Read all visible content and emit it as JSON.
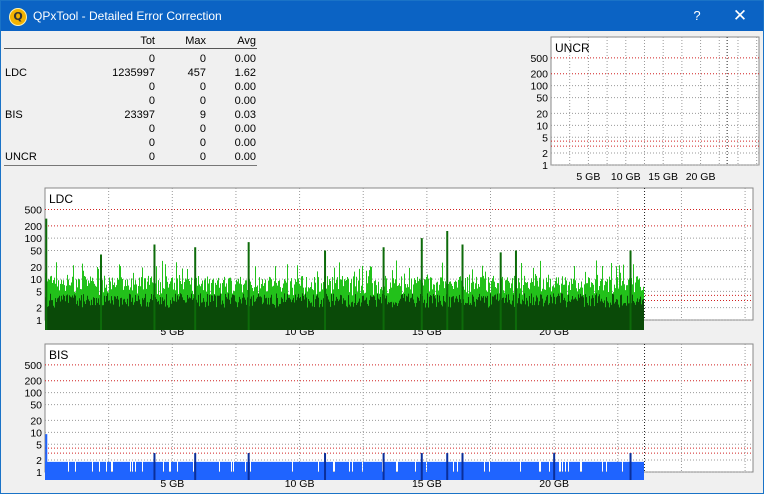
{
  "window": {
    "title": "QPxTool - Detailed Error Correction",
    "help_label": "?",
    "close_label": "✕",
    "app_icon_letter": "Q"
  },
  "stats": {
    "headers": {
      "tot": "Tot",
      "max": "Max",
      "avg": "Avg"
    },
    "rows": [
      {
        "label": "",
        "tot": "0",
        "max": "0",
        "avg": "0.00"
      },
      {
        "label": "LDC",
        "tot": "1235997",
        "max": "457",
        "avg": "1.62"
      },
      {
        "label": "",
        "tot": "0",
        "max": "0",
        "avg": "0.00"
      },
      {
        "label": "",
        "tot": "0",
        "max": "0",
        "avg": "0.00"
      },
      {
        "label": "BIS",
        "tot": "23397",
        "max": "9",
        "avg": "0.03"
      },
      {
        "label": "",
        "tot": "0",
        "max": "0",
        "avg": "0.00"
      },
      {
        "label": "",
        "tot": "0",
        "max": "0",
        "avg": "0.00"
      },
      {
        "label": "UNCR",
        "tot": "0",
        "max": "0",
        "avg": "0.00"
      }
    ]
  },
  "chart_data": [
    {
      "type": "bar",
      "title": "UNCR",
      "y_scale": "log",
      "y_ticks": [
        "500",
        "200",
        "100",
        "50",
        "20",
        "10",
        "5",
        "2",
        "1"
      ],
      "x_ticks": [
        "5 GB",
        "10 GB",
        "15 GB",
        "20 GB"
      ],
      "x_unit": "GB",
      "x_range": [
        0,
        23.5
      ],
      "series": [
        {
          "color": "#1a4fd1",
          "values": []
        }
      ],
      "grid": true
    },
    {
      "type": "bar",
      "title": "LDC",
      "y_scale": "log",
      "y_ticks": [
        "500",
        "200",
        "100",
        "50",
        "20",
        "10",
        "5",
        "2",
        "1"
      ],
      "x_ticks": [
        "5 GB",
        "10 GB",
        "15 GB",
        "20 GB"
      ],
      "x_unit": "GB",
      "x_range": [
        0,
        23.5
      ],
      "colors": {
        "fill": "#22c11a",
        "dark": "#0a4a08",
        "spike": "#0d6b0a"
      },
      "typical_max": 8,
      "max": 457,
      "spike_positions_gb": [
        0.05,
        2.2,
        4.3,
        5.9,
        8.0,
        11.0,
        13.3,
        14.8,
        15.8,
        16.4,
        17.9,
        18.5,
        23.0
      ],
      "spike_heights": [
        300,
        40,
        70,
        60,
        80,
        50,
        60,
        100,
        150,
        70,
        45,
        50,
        50
      ],
      "grid": true
    },
    {
      "type": "bar",
      "title": "BIS",
      "y_scale": "log",
      "y_ticks": [
        "500",
        "200",
        "100",
        "50",
        "20",
        "10",
        "5",
        "2",
        "1"
      ],
      "x_ticks": [
        "5 GB",
        "10 GB",
        "15 GB",
        "20 GB"
      ],
      "x_unit": "GB",
      "x_range": [
        0,
        23.5
      ],
      "colors": {
        "fill": "#1f64ff",
        "spike": "#0b2f9a"
      },
      "max": 9,
      "spike_positions_gb": [
        0.05,
        4.3,
        5.9,
        8.0,
        11.0,
        13.3,
        14.8,
        15.8,
        16.4,
        20.0,
        23.0
      ],
      "spike_heights": [
        9,
        3,
        3,
        3,
        3,
        3,
        3,
        3,
        3,
        3,
        3
      ],
      "grid": true
    }
  ]
}
